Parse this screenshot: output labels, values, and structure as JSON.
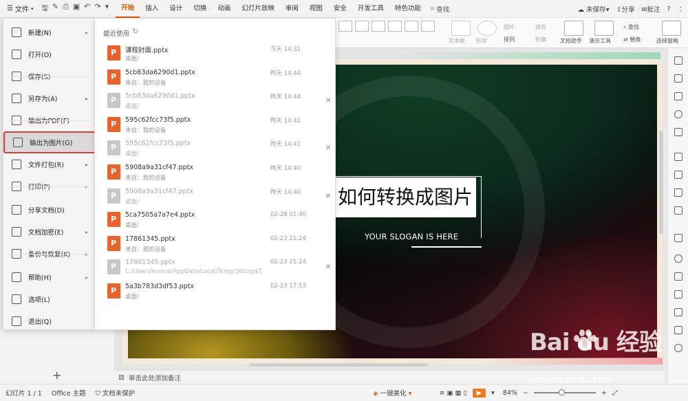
{
  "topbar": {
    "file_label": "文件",
    "tabs": [
      "开始",
      "插入",
      "设计",
      "切换",
      "动画",
      "幻灯片放映",
      "审阅",
      "视图",
      "安全",
      "开发工具",
      "特色功能"
    ],
    "active_tab": "开始",
    "search_label": "查找",
    "unsaved_label": "未保存",
    "share_label": "分享",
    "comment_label": "批注",
    "help_label": "?",
    "more_label": "︰"
  },
  "ribbon": {
    "textbox": "文本框",
    "shape": "形状",
    "picture": "图片",
    "fill": "填充",
    "arrange": "排列",
    "outline": "轮廓",
    "doc_helper": "文档助手",
    "present_tools": "演示工具",
    "find": "查找",
    "replace": "替换",
    "select_pane": "选择窗格"
  },
  "file_menu": {
    "items": [
      {
        "label": "新建(N)",
        "icon": "new-icon",
        "arrow": true
      },
      {
        "label": "打开(O)",
        "icon": "folder-icon",
        "arrow": false
      },
      {
        "label": "保存(S)",
        "icon": "save-icon",
        "arrow": false
      },
      {
        "label": "另存为(A)",
        "icon": "save-as-icon",
        "arrow": true
      },
      {
        "label": "输出为PDF(F)",
        "icon": "pdf-icon",
        "arrow": false
      },
      {
        "label": "输出为图片(G)",
        "icon": "image-export-icon",
        "arrow": false,
        "highlighted": true
      },
      {
        "label": "文件打包(R)",
        "icon": "package-icon",
        "arrow": true
      },
      {
        "label": "打印(P)",
        "icon": "print-icon",
        "arrow": true
      },
      {
        "label": "分享文档(D)",
        "icon": "share-icon",
        "arrow": false
      },
      {
        "label": "文档加密(E)",
        "icon": "lock-icon",
        "arrow": true
      },
      {
        "label": "备份与恢复(K)",
        "icon": "backup-icon",
        "arrow": true
      },
      {
        "label": "帮助(H)",
        "icon": "help-icon",
        "arrow": true
      },
      {
        "label": "选项(L)",
        "icon": "gear-icon",
        "arrow": false
      },
      {
        "label": "退出(Q)",
        "icon": "exit-icon",
        "arrow": false
      }
    ]
  },
  "recent": {
    "title": "最近使用",
    "files": [
      {
        "name": "课程封面.pptx",
        "sub": "桌面/",
        "time": "今天 14:31",
        "gray": false,
        "close": false
      },
      {
        "name": "5cb83da6290d1.pptx",
        "sub": "来自：我的设备",
        "time": "昨天 14:44",
        "gray": false,
        "close": false
      },
      {
        "name": "5cb83da6290d1.pptx",
        "sub": "桌面/",
        "time": "昨天 14:44",
        "gray": true,
        "close": true
      },
      {
        "name": "595c62fcc73f5.pptx",
        "sub": "来自：我的设备",
        "time": "昨天 14:41",
        "gray": false,
        "close": false
      },
      {
        "name": "595c62fcc73f5.pptx",
        "sub": "桌面/",
        "time": "昨天 14:41",
        "gray": true,
        "close": true
      },
      {
        "name": "5908a9a31cf47.pptx",
        "sub": "来自：我的设备",
        "time": "昨天 14:40",
        "gray": false,
        "close": false
      },
      {
        "name": "5908a9a31cf47.pptx",
        "sub": "桌面/",
        "time": "昨天 14:40",
        "gray": true,
        "close": true
      },
      {
        "name": "5ca7505a7a7e4.pptx",
        "sub": "桌面/",
        "time": "02-28 01:40",
        "gray": false,
        "close": false
      },
      {
        "name": "17861345.pptx",
        "sub": "来自：我的设备",
        "time": "02-23 21:24",
        "gray": false,
        "close": false
      },
      {
        "name": "17861345.pptx",
        "sub": "C:/Users/lenovo/AppData/Local/Temp/360zip$T...",
        "time": "02-23 21:24",
        "gray": true,
        "close": true
      },
      {
        "name": "5a3b783d3df53.pptx",
        "sub": "桌面/",
        "time": "02-23 17:53",
        "gray": false,
        "close": false
      }
    ]
  },
  "slide": {
    "title": "如何转换成图片",
    "slogan": "YOUR SLOGAN IS HERE"
  },
  "notes_placeholder": "单击此处添加备注",
  "status": {
    "slide_count": "幻灯片 1 / 1",
    "theme": "Office 主题",
    "protect": "文档未保护",
    "beautify": "一键美化",
    "zoom": "84%"
  },
  "watermark": {
    "brand": "Bai du 经验",
    "url": "jingyan.baidu.com"
  }
}
